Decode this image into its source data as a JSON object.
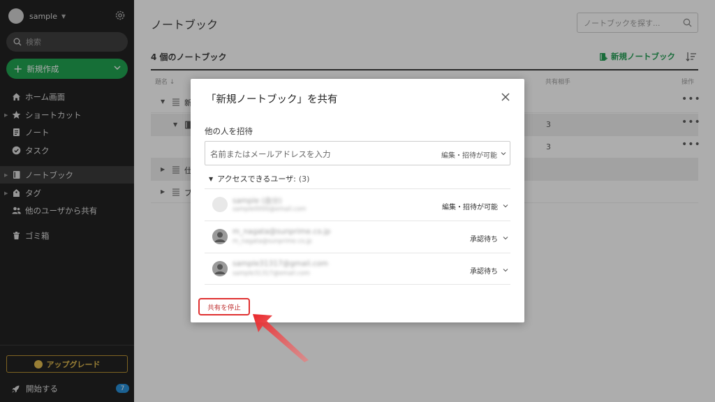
{
  "sidebar": {
    "account_name": "sample",
    "search_label": "検索",
    "new_label": "新規作成",
    "items": [
      {
        "label": "ホーム画面"
      },
      {
        "label": "ショートカット"
      },
      {
        "label": "ノート"
      },
      {
        "label": "タスク"
      },
      {
        "label": "ノートブック"
      },
      {
        "label": "タグ"
      },
      {
        "label": "他のユーザから共有"
      },
      {
        "label": "ゴミ箱"
      }
    ],
    "upgrade_label": "アップグレード",
    "start_label": "開始する",
    "start_badge": "7"
  },
  "main": {
    "title": "ノートブック",
    "search_placeholder": "ノートブックを探す...",
    "count_title": "4 個のノートブック",
    "new_notebook_label": "新規ノートブック",
    "columns": {
      "name": "題名",
      "shared_with": "共有相手",
      "actions": "操作"
    },
    "rows": [
      {
        "name": "新",
        "share": ""
      },
      {
        "name": "",
        "share": "3"
      },
      {
        "name": "",
        "share": "3"
      },
      {
        "name": "仕",
        "share": ""
      },
      {
        "name": "プ",
        "share": ""
      }
    ],
    "more": "•••"
  },
  "modal": {
    "title": "「新規ノートブック」を共有",
    "invite_label": "他の人を招待",
    "invite_placeholder": "名前またはメールアドレスを入力",
    "invite_permission": "編集・招待が可能",
    "access_label": "アクセスできるユーザ:",
    "access_count": "(3)",
    "users": [
      {
        "name": "sample (自分)",
        "email": "sample0000@email.com",
        "role": "編集・招待が可能"
      },
      {
        "name": "m_nagata@sunprime.co.jp",
        "email": "m_nagata@sunprime.co.jp",
        "role": "承認待ち"
      },
      {
        "name": "sample31317@gmail.com",
        "email": "sample31317@email.com",
        "role": "承認待ち"
      }
    ],
    "stop_sharing": "共有を停止"
  },
  "colors": {
    "sidebar_bg": "#1a1a1a",
    "accent_green": "#18a04a",
    "upgrade_gold": "#e0b848",
    "highlight_red": "#e03030"
  }
}
